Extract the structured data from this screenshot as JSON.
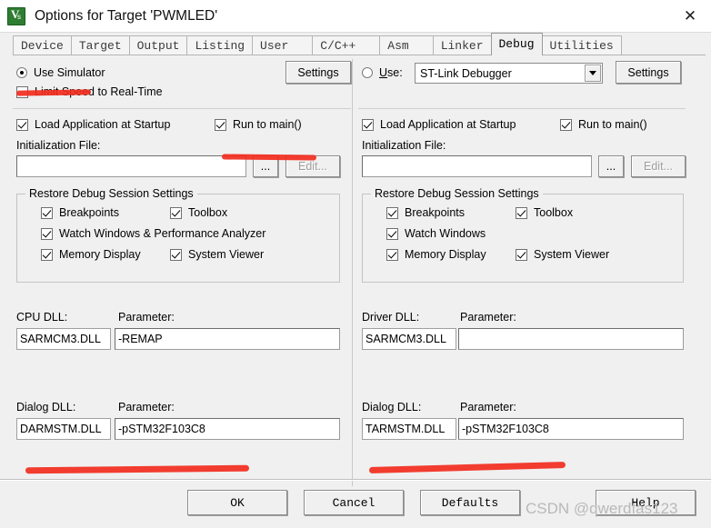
{
  "window": {
    "title": "Options for Target 'PWMLED'",
    "icon": "keil-uvision-icon",
    "close_label": "✕"
  },
  "tabs": [
    {
      "label": "Device",
      "active": false
    },
    {
      "label": "Target",
      "active": false
    },
    {
      "label": "Output",
      "active": false
    },
    {
      "label": "Listing",
      "active": false
    },
    {
      "label": "User",
      "active": false
    },
    {
      "label": "C/C++",
      "active": false
    },
    {
      "label": "Asm",
      "active": false
    },
    {
      "label": "Linker",
      "active": false
    },
    {
      "label": "Debug",
      "active": true
    },
    {
      "label": "Utilities",
      "active": false
    }
  ],
  "left": {
    "use_simulator_label": "Use Simulator",
    "use_simulator_checked": true,
    "settings_label": "Settings",
    "limit_speed_label": "Limit Speed to Real-Time",
    "limit_speed_checked": false,
    "load_app_label": "Load Application at Startup",
    "load_app_checked": true,
    "run_to_main_label": "Run to main()",
    "run_to_main_checked": true,
    "init_file_label": "Initialization File:",
    "init_file_value": "",
    "browse_label": "...",
    "edit_label": "Edit...",
    "restore_group_title": "Restore Debug Session Settings",
    "restore_items": [
      {
        "label": "Breakpoints",
        "checked": true
      },
      {
        "label": "Toolbox",
        "checked": true
      },
      {
        "label": "Watch Windows & Performance Analyzer",
        "checked": true
      },
      {
        "label": "Memory Display",
        "checked": true
      },
      {
        "label": "System Viewer",
        "checked": true
      }
    ],
    "cpu_dll_label": "CPU DLL:",
    "cpu_dll_value": "SARMCM3.DLL",
    "cpu_param_label": "Parameter:",
    "cpu_param_value": "-REMAP",
    "dialog_dll_label": "Dialog DLL:",
    "dialog_dll_value": "DARMSTM.DLL",
    "dialog_param_label": "Parameter:",
    "dialog_param_value": "-pSTM32F103C8"
  },
  "right": {
    "use_label": "Use:",
    "use_checked": false,
    "debugger_value": "ST-Link Debugger",
    "settings_label": "Settings",
    "load_app_label": "Load Application at Startup",
    "load_app_checked": true,
    "run_to_main_label": "Run to main()",
    "run_to_main_checked": true,
    "init_file_label": "Initialization File:",
    "init_file_value": "",
    "browse_label": "...",
    "edit_label": "Edit...",
    "restore_group_title": "Restore Debug Session Settings",
    "restore_items": [
      {
        "label": "Breakpoints",
        "checked": true
      },
      {
        "label": "Toolbox",
        "checked": true
      },
      {
        "label": "Watch Windows",
        "checked": true
      },
      {
        "label": "Memory Display",
        "checked": true
      },
      {
        "label": "System Viewer",
        "checked": true
      }
    ],
    "driver_dll_label": "Driver DLL:",
    "driver_dll_value": "SARMCM3.DLL",
    "driver_param_label": "Parameter:",
    "driver_param_value": "",
    "dialog_dll_label": "Dialog DLL:",
    "dialog_dll_value": "TARMSTM.DLL",
    "dialog_param_label": "Parameter:",
    "dialog_param_value": "-pSTM32F103C8"
  },
  "footer": {
    "ok_label": "OK",
    "cancel_label": "Cancel",
    "defaults_label": "Defaults",
    "help_label": "Help"
  },
  "watermark": {
    "text": "CSDN @qwerdfas123"
  },
  "annotation_color": "#f22c1e"
}
